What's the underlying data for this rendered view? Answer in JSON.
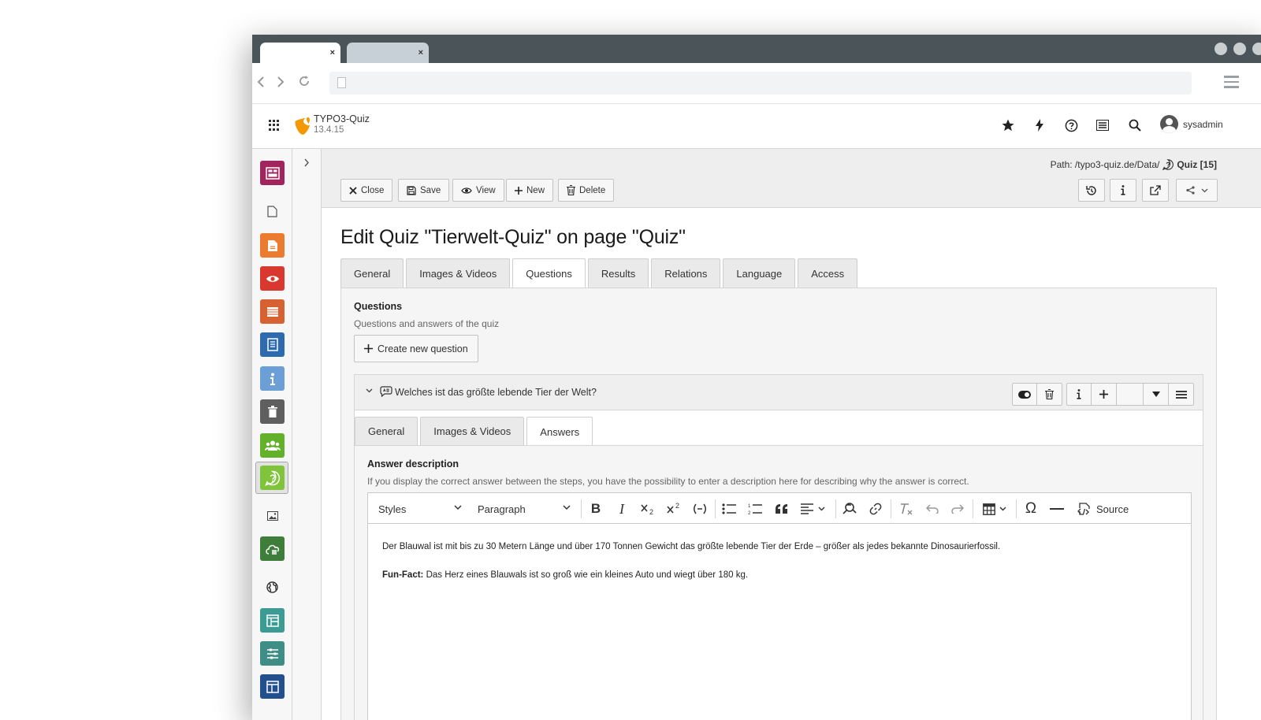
{
  "browser": {
    "tabs": [
      {
        "close": "×"
      },
      {
        "close": "×"
      }
    ]
  },
  "topbar": {
    "site_name": "TYPO3-Quiz",
    "site_version": "13.4.15",
    "username": "sysadmin"
  },
  "docheader": {
    "path_prefix": "Path: /typo3-quiz.de/Data/",
    "record": "Quiz [15]",
    "buttons": {
      "close": "Close",
      "save": "Save",
      "view": "View",
      "new": "New",
      "delete": "Delete"
    }
  },
  "page_title": "Edit Quiz \"Tierwelt-Quiz\" on page \"Quiz\"",
  "tabs": [
    "General",
    "Images & Videos",
    "Questions",
    "Results",
    "Relations",
    "Language",
    "Access"
  ],
  "questions_field": {
    "label": "Questions",
    "description": "Questions and answers of the quiz",
    "create_button": "Create new question"
  },
  "question_record": {
    "title": "Welches ist das größte lebende Tier der Welt?",
    "subtabs": [
      "General",
      "Images & Videos",
      "Answers"
    ],
    "answer_label": "Answer description",
    "answer_description": "If you display the correct answer between the steps, you have the possibility to enter a description here for describing why the answer is correct."
  },
  "editor": {
    "styles": "Styles",
    "paragraph": "Paragraph",
    "source": "Source",
    "paragraph1": "Der Blauwal ist mit bis zu 30 Metern Länge und über 170 Tonnen Gewicht das größte lebende Tier der Erde – größer als jedes bekannte Dinosaurierfossil.",
    "funfact_label": "Fun-Fact:",
    "funfact_text": " Das Herz eines Blauwals ist so groß wie ein kleines Auto und wiegt über 180 kg."
  },
  "colors": {
    "typo3_orange": "#f49700",
    "chrome": "#4a5459"
  }
}
